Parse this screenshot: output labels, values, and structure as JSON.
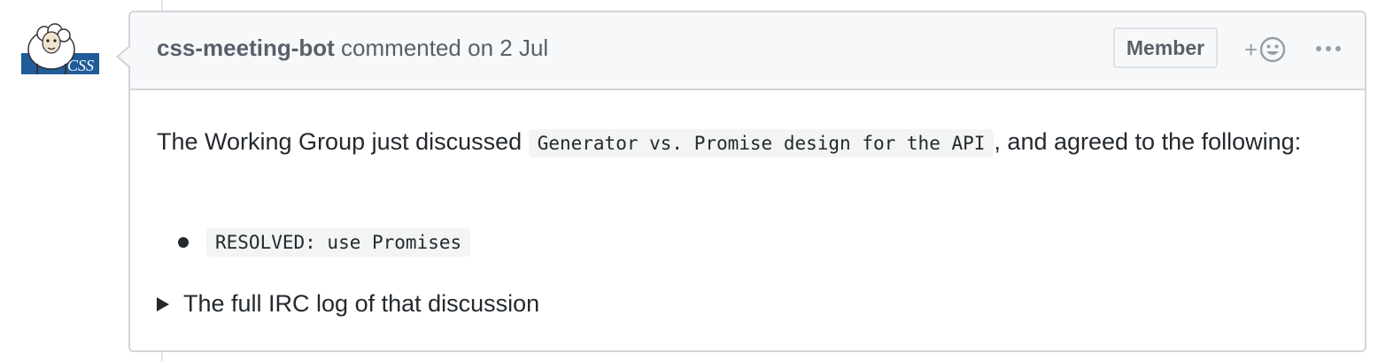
{
  "avatar": {
    "icon": "sheep-logo-icon",
    "label": "CSS",
    "brand_color": "#1f5c99"
  },
  "comment": {
    "author": "css-meeting-bot",
    "action": "commented on",
    "date": "2 Jul",
    "badge": "Member",
    "reaction_plus": "+",
    "reaction_icon": "smiley-icon",
    "more_icon": "ellipsis-icon"
  },
  "body": {
    "intro_before": "The Working Group just discussed ",
    "topic": "Generator vs. Promise design for the API",
    "intro_after": ", and agreed to the following:",
    "resolutions": [
      "RESOLVED: use Promises"
    ],
    "details_summary": "The full IRC log of that discussion"
  }
}
